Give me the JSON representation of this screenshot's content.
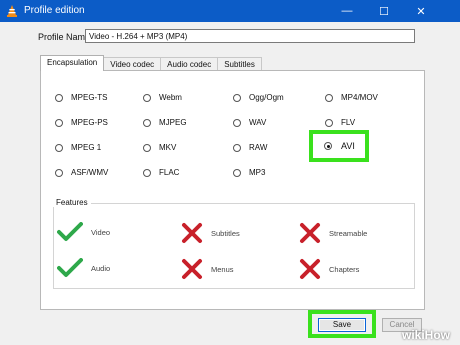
{
  "window": {
    "title": "Profile edition",
    "controls": {
      "minimize": "—",
      "maximize": "☐",
      "close": "✕"
    }
  },
  "profile": {
    "label": "Profile Name",
    "value": "Video - H.264 + MP3 (MP4)"
  },
  "tabs": [
    {
      "label": "Encapsulation",
      "active": true
    },
    {
      "label": "Video codec",
      "active": false
    },
    {
      "label": "Audio codec",
      "active": false
    },
    {
      "label": "Subtitles",
      "active": false
    }
  ],
  "encapsulation": {
    "options": [
      {
        "label": "MPEG-TS",
        "checked": false
      },
      {
        "label": "Webm",
        "checked": false
      },
      {
        "label": "Ogg/Ogm",
        "checked": false
      },
      {
        "label": "MP4/MOV",
        "checked": false
      },
      {
        "label": "MPEG-PS",
        "checked": false
      },
      {
        "label": "MJPEG",
        "checked": false
      },
      {
        "label": "WAV",
        "checked": false
      },
      {
        "label": "FLV",
        "checked": false
      },
      {
        "label": "MPEG 1",
        "checked": false
      },
      {
        "label": "MKV",
        "checked": false
      },
      {
        "label": "RAW",
        "checked": false
      },
      {
        "label": "AVI",
        "checked": true
      },
      {
        "label": "ASF/WMV",
        "checked": false
      },
      {
        "label": "FLAC",
        "checked": false
      },
      {
        "label": "MP3",
        "checked": false
      }
    ]
  },
  "features": {
    "legend": "Features",
    "items": [
      {
        "label": "Video",
        "supported": true
      },
      {
        "label": "Subtitles",
        "supported": false
      },
      {
        "label": "Streamable",
        "supported": false
      },
      {
        "label": "Audio",
        "supported": true
      },
      {
        "label": "Menus",
        "supported": false
      },
      {
        "label": "Chapters",
        "supported": false
      }
    ]
  },
  "buttons": {
    "save": "Save",
    "cancel": "Cancel"
  },
  "watermark": "wikiHow",
  "colors": {
    "titlebar": "#0c5cc7",
    "highlight": "#3ae11d",
    "check": "#2ea84a",
    "cross": "#c8202a"
  }
}
